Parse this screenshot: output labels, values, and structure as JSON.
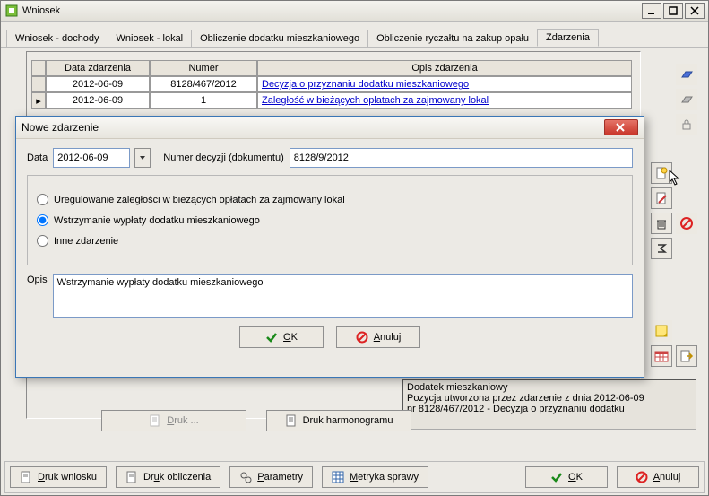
{
  "window": {
    "title": "Wniosek"
  },
  "tabs": {
    "t0": "Wniosek - dochody",
    "t1": "Wniosek - lokal",
    "t2": "Obliczenie dodatku mieszkaniowego",
    "t3": "Obliczenie ryczałtu na zakup opału",
    "t4": "Zdarzenia"
  },
  "events_table": {
    "col_date": "Data zdarzenia",
    "col_num": "Numer",
    "col_desc": "Opis zdarzenia",
    "r0": {
      "date": "2012-06-09",
      "num": "8128/467/2012",
      "desc": "Decyzja o przyznaniu dodatku mieszkaniowego"
    },
    "r1": {
      "date": "2012-06-09",
      "num": "1",
      "desc": "Zaległość w bieżących opłatach za zajmowany lokal"
    }
  },
  "detail": {
    "line1": "Dodatek mieszkaniowy",
    "line2": "Pozycja utworzona przez zdarzenie z dnia 2012-06-09",
    "line3": "nr 8128/467/2012 - Decyzja o przyznaniu dodatku"
  },
  "buttons": {
    "druk": "Druk ...",
    "druk_harm": "Druk harmonogramu",
    "druk_wniosku": "Druk wniosku",
    "druk_obliczenia": "Druk obliczenia",
    "parametry": "Parametry",
    "metryka": "Metryka sprawy",
    "ok": "OK",
    "anuluj": "Anuluj"
  },
  "modal": {
    "title": "Nowe zdarzenie",
    "lbl_data": "Data",
    "date": "2012-06-09",
    "lbl_numer": "Numer decyzji (dokumentu)",
    "numer": "8128/9/2012",
    "opt1": "Uregulowanie zaległości w bieżących opłatach za zajmowany lokal",
    "opt2": "Wstrzymanie wypłaty dodatku mieszkaniowego",
    "opt3": "Inne zdarzenie",
    "lbl_opis": "Opis",
    "opis": "Wstrzymanie wypłaty dodatku mieszkaniowego",
    "ok": "OK",
    "anuluj": "Anuluj"
  }
}
